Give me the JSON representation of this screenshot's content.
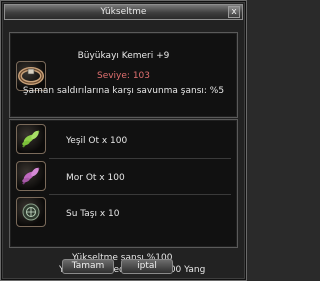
{
  "window": {
    "title": "Yükseltme",
    "close_glyph": "x"
  },
  "item": {
    "icon": "belt-icon",
    "name": "Büyükayı Kemeri +9",
    "level": "Seviye: 103",
    "bonus": "Şaman saldırılarına karşı savunma şansı: %5"
  },
  "materials": [
    {
      "icon": "green-herb-icon",
      "label": "Yeşil Ot x 100"
    },
    {
      "icon": "purple-herb-icon",
      "label": "Mor Ot x 100"
    },
    {
      "icon": "water-stone-icon",
      "label": "Su Taşı x 10"
    }
  ],
  "summary": {
    "chance": "Yükseltme şansı %100",
    "cost": "Yükseltme bedeli: 1000000 Yang"
  },
  "buttons": {
    "ok": "Tamam",
    "cancel": "iptal"
  }
}
